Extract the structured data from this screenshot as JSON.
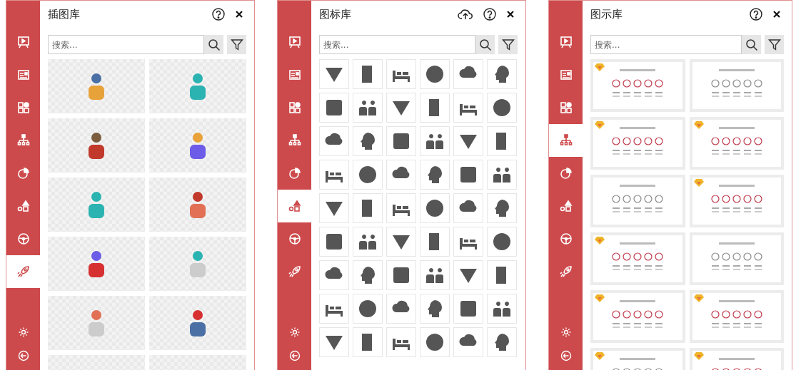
{
  "panels": [
    {
      "kind": "illustrations",
      "title": "插图库",
      "upload_button": false,
      "search": {
        "placeholder": "搜索..."
      },
      "nav": [
        {
          "selected": false
        },
        {
          "selected": false
        },
        {
          "selected": false
        },
        {
          "selected": false
        },
        {
          "selected": false
        },
        {
          "selected": false
        },
        {
          "selected": false
        },
        {
          "selected": true
        }
      ]
    },
    {
      "kind": "icons",
      "title": "图标库",
      "upload_button": true,
      "search": {
        "placeholder": "搜索..."
      },
      "nav": [
        {
          "selected": false
        },
        {
          "selected": false
        },
        {
          "selected": false
        },
        {
          "selected": false
        },
        {
          "selected": false
        },
        {
          "selected": true
        },
        {
          "selected": false
        },
        {
          "selected": false
        }
      ]
    },
    {
      "kind": "diagrams",
      "title": "图示库",
      "upload_button": false,
      "search": {
        "placeholder": "搜索..."
      },
      "nav": [
        {
          "selected": false
        },
        {
          "selected": false
        },
        {
          "selected": false
        },
        {
          "selected": true
        },
        {
          "selected": false
        },
        {
          "selected": false
        },
        {
          "selected": false
        },
        {
          "selected": false
        }
      ],
      "slides": [
        {
          "badge": true
        },
        {
          "badge": false
        },
        {
          "badge": true
        },
        {
          "badge": true
        },
        {
          "badge": false
        },
        {
          "badge": true
        },
        {
          "badge": true
        },
        {
          "badge": false
        },
        {
          "badge": true
        },
        {
          "badge": true
        },
        {
          "badge": true
        },
        {
          "badge": true
        }
      ]
    }
  ]
}
